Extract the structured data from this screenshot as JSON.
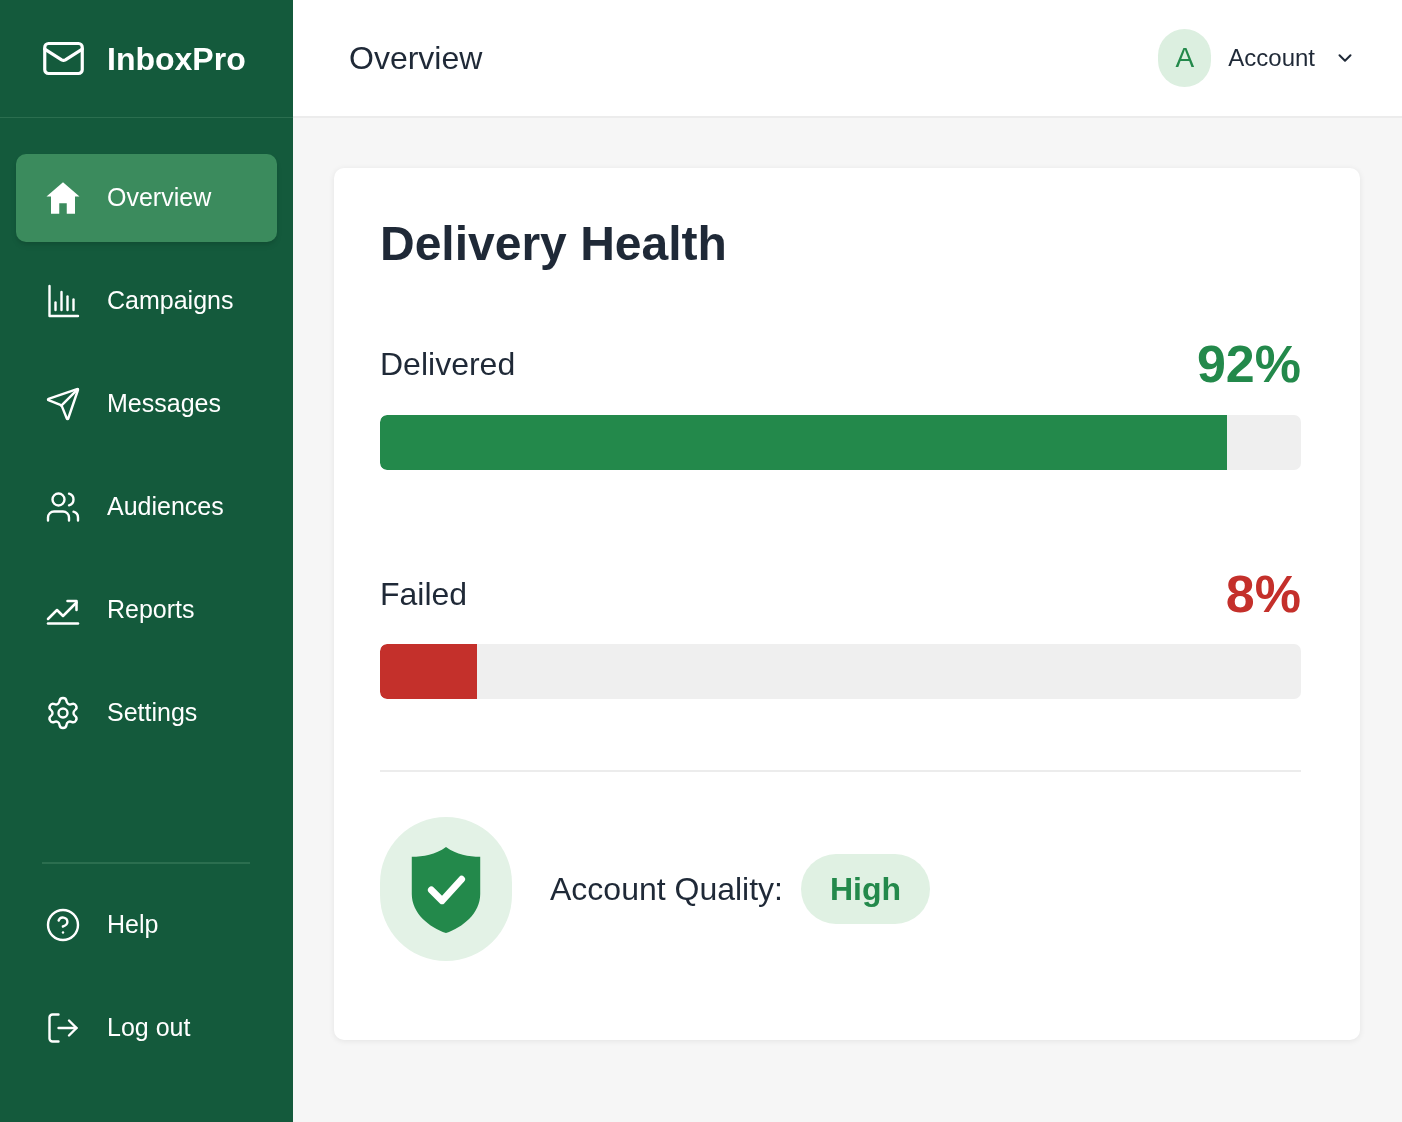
{
  "sidebar": {
    "brand": "InboxPro",
    "items": [
      {
        "label": "Overview",
        "selected": true
      },
      {
        "label": "Campaigns",
        "selected": false
      },
      {
        "label": "Messages",
        "selected": false
      },
      {
        "label": "Audiences",
        "selected": false
      },
      {
        "label": "Reports",
        "selected": false
      },
      {
        "label": "Settings",
        "selected": false
      }
    ],
    "footer_items": [
      {
        "label": "Help"
      },
      {
        "label": "Log out"
      }
    ]
  },
  "header": {
    "title": "Overview",
    "account": {
      "avatar_letter": "A",
      "label": "Account"
    }
  },
  "card": {
    "title": "Delivery Health",
    "metrics": [
      {
        "label": "Delivered",
        "reading": "92%",
        "level": 0.92,
        "color": "#23894b"
      },
      {
        "label": "Failed",
        "reading": "8%",
        "level": 0.105,
        "color": "#c4302b"
      }
    ],
    "quality": {
      "label": "Account Quality:",
      "badge": "High"
    }
  }
}
